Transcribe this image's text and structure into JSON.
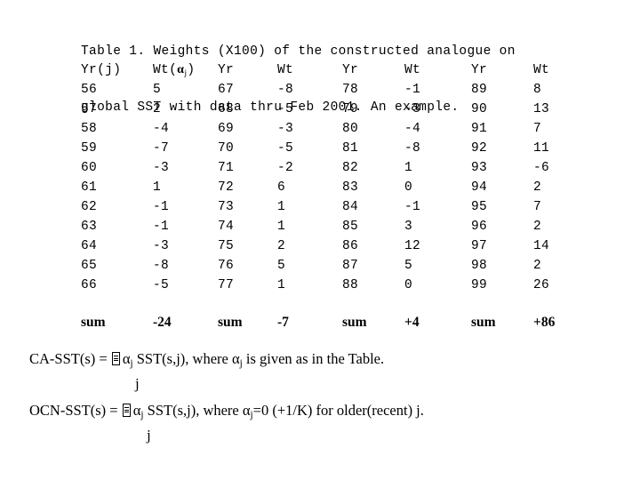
{
  "document": {
    "background_color": "#ffffff",
    "text_color": "#000000"
  },
  "title": {
    "line1": "Table 1. Weights (X100) of the constructed analogue on",
    "line2": "global SST with data thru Feb 2001. An example."
  },
  "table": {
    "headers": {
      "yr_j": "Yr(j)",
      "wt_alpha_prefix": "Wt(",
      "wt_alpha_symbol": "α",
      "wt_alpha_sub": "j",
      "wt_alpha_suffix": ")",
      "yr": "Yr",
      "wt": "Wt"
    },
    "header_row": [
      "Yr(j)",
      "Wt(αj)",
      "Yr",
      "Wt",
      "Yr",
      "Wt",
      "Yr",
      "Wt"
    ],
    "rows": [
      [
        "56",
        "5",
        "67",
        "-8",
        "78",
        "-1",
        "89",
        "8"
      ],
      [
        "57",
        "2",
        "68",
        "-5",
        "79",
        "-3",
        "90",
        "13"
      ],
      [
        "58",
        "-4",
        "69",
        "-3",
        "80",
        "-4",
        "91",
        "7"
      ],
      [
        "59",
        "-7",
        "70",
        "-5",
        "81",
        "-8",
        "92",
        "11"
      ],
      [
        "60",
        "-3",
        "71",
        "-2",
        "82",
        "1",
        "93",
        "-6"
      ],
      [
        "61",
        "1",
        "72",
        "6",
        "83",
        "0",
        "94",
        "2"
      ],
      [
        "62",
        "-1",
        "73",
        "1",
        "84",
        "-1",
        "95",
        "7"
      ],
      [
        "63",
        "-1",
        "74",
        "1",
        "85",
        "3",
        "96",
        "2"
      ],
      [
        "64",
        "-3",
        "75",
        "2",
        "86",
        "12",
        "97",
        "14"
      ],
      [
        "65",
        "-8",
        "76",
        "5",
        "87",
        "5",
        "98",
        "2"
      ],
      [
        "66",
        "-5",
        "77",
        "1",
        "88",
        "0",
        "99",
        "26"
      ]
    ],
    "sum_row": {
      "label": "sum",
      "values": [
        "-24",
        "-7",
        "+4",
        "+86"
      ],
      "cells": [
        "sum",
        "-24",
        "sum",
        "-7",
        "sum",
        "+4",
        "sum",
        "+86"
      ]
    }
  },
  "formulas": {
    "line1": {
      "lhs": "CA-SST(s) = ",
      "sum_symbol": "∑",
      "alpha": "α",
      "alpha_sub": "j",
      "mid": " SST(s,j), where ",
      "alpha2": "α",
      "alpha2_sub": "j",
      "tail": "  is given as in the Table.",
      "index": "j",
      "full_text": "CA-SST(s) = ∑ αj SST(s,j), where αj  is given as in the Table."
    },
    "line2": {
      "lhs": "OCN-SST(s) = ",
      "sum_symbol": "∑",
      "alpha": "α",
      "alpha_sub": "j",
      "mid": " SST(s,j),  where ",
      "alpha2": "α",
      "alpha2_sub": "j",
      "tail": "=0 (+1/K) for older(recent) j.",
      "index": "j",
      "full_text": "OCN-SST(s) = ∑ αj SST(s,j),  where αj=0 (+1/K) for older(recent) j."
    }
  }
}
